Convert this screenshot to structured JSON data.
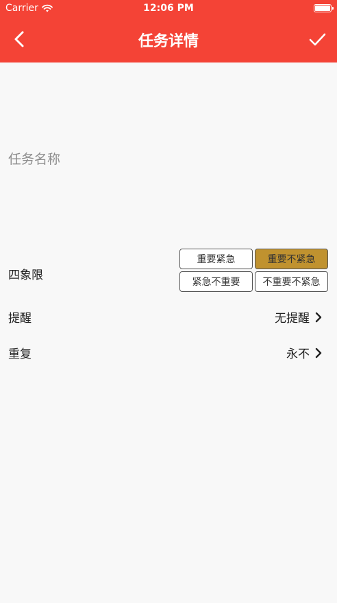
{
  "status_bar": {
    "carrier": "Carrier",
    "time": "12:06 PM"
  },
  "nav": {
    "title": "任务详情"
  },
  "task_name": {
    "placeholder": "任务名称",
    "value": ""
  },
  "quadrant": {
    "label": "四象限",
    "options": [
      "重要紧急",
      "重要不紧急",
      "紧急不重要",
      "不重要不紧急"
    ],
    "selected": "重要不紧急"
  },
  "reminder": {
    "label": "提醒",
    "value": "无提醒"
  },
  "repeat": {
    "label": "重复",
    "value": "永不"
  },
  "colors": {
    "header": "#f44336",
    "selected_quadrant": "#c0922f",
    "background": "#f8f8f8"
  },
  "icons": [
    "wifi-icon",
    "battery-icon",
    "back-chevron-icon",
    "checkmark-icon",
    "chevron-right-icon"
  ]
}
